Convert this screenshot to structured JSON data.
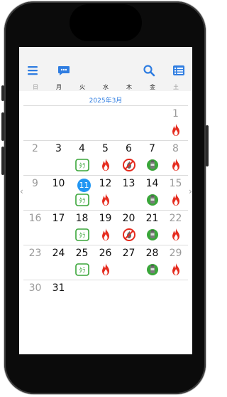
{
  "toolbar": {
    "menu_icon": "menu-icon",
    "chat_icon": "chat-bubble-icon",
    "search_icon": "search-icon",
    "list_icon": "list-view-icon",
    "accent": "#2f7de1"
  },
  "weekdays": [
    "日",
    "月",
    "火",
    "水",
    "木",
    "金",
    "土"
  ],
  "month_label": "2025年3月",
  "today": 11,
  "weeks": [
    [
      {
        "d": "",
        "g": false,
        "i": ""
      },
      {
        "d": "",
        "g": false,
        "i": ""
      },
      {
        "d": "",
        "g": false,
        "i": ""
      },
      {
        "d": "",
        "g": false,
        "i": ""
      },
      {
        "d": "",
        "g": false,
        "i": ""
      },
      {
        "d": "",
        "g": false,
        "i": ""
      },
      {
        "d": "1",
        "g": true,
        "i": "burnable"
      }
    ],
    [
      {
        "d": "2",
        "g": true,
        "i": ""
      },
      {
        "d": "3",
        "g": false,
        "i": ""
      },
      {
        "d": "4",
        "g": false,
        "i": "recyclable"
      },
      {
        "d": "5",
        "g": false,
        "i": "burnable"
      },
      {
        "d": "6",
        "g": false,
        "i": "non-burnable"
      },
      {
        "d": "7",
        "g": false,
        "i": "resource"
      },
      {
        "d": "8",
        "g": true,
        "i": "burnable"
      }
    ],
    [
      {
        "d": "9",
        "g": true,
        "i": ""
      },
      {
        "d": "10",
        "g": false,
        "i": ""
      },
      {
        "d": "11",
        "g": false,
        "i": "recyclable"
      },
      {
        "d": "12",
        "g": false,
        "i": "burnable"
      },
      {
        "d": "13",
        "g": false,
        "i": ""
      },
      {
        "d": "14",
        "g": false,
        "i": "resource"
      },
      {
        "d": "15",
        "g": true,
        "i": "burnable"
      }
    ],
    [
      {
        "d": "16",
        "g": true,
        "i": ""
      },
      {
        "d": "17",
        "g": false,
        "i": ""
      },
      {
        "d": "18",
        "g": false,
        "i": "recyclable"
      },
      {
        "d": "19",
        "g": false,
        "i": "burnable"
      },
      {
        "d": "20",
        "g": false,
        "i": "non-burnable"
      },
      {
        "d": "21",
        "g": false,
        "i": "resource"
      },
      {
        "d": "22",
        "g": true,
        "i": "burnable"
      }
    ],
    [
      {
        "d": "23",
        "g": true,
        "i": ""
      },
      {
        "d": "24",
        "g": false,
        "i": ""
      },
      {
        "d": "25",
        "g": false,
        "i": "recyclable"
      },
      {
        "d": "26",
        "g": false,
        "i": "burnable"
      },
      {
        "d": "27",
        "g": false,
        "i": ""
      },
      {
        "d": "28",
        "g": false,
        "i": "resource"
      },
      {
        "d": "29",
        "g": true,
        "i": "burnable"
      }
    ],
    [
      {
        "d": "30",
        "g": true,
        "i": ""
      },
      {
        "d": "31",
        "g": false,
        "i": ""
      },
      {
        "d": "",
        "g": false,
        "i": ""
      },
      {
        "d": "",
        "g": false,
        "i": ""
      },
      {
        "d": "",
        "g": false,
        "i": ""
      },
      {
        "d": "",
        "g": false,
        "i": ""
      },
      {
        "d": "",
        "g": false,
        "i": ""
      }
    ]
  ],
  "icon_text": {
    "recyclable": "ﾀﾗ"
  },
  "nav": {
    "prev": "‹",
    "next": "›"
  }
}
